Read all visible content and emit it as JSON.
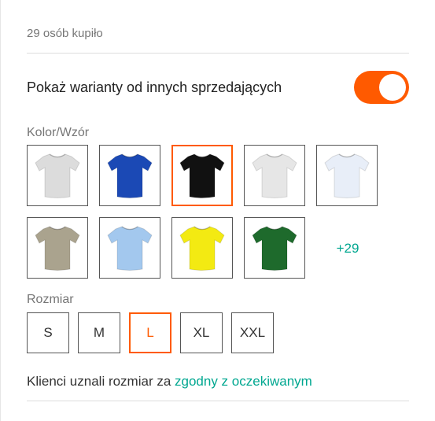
{
  "purchased_text": "29 osób kupiło",
  "toggle": {
    "label": "Pokaż warianty od innych sprzedających",
    "on": true,
    "color": "#ff5a00"
  },
  "color_section": {
    "label": "Kolor/Wzór",
    "swatches": [
      {
        "name": "light-gray",
        "color": "#dcdcdc",
        "selected": false
      },
      {
        "name": "royal-blue",
        "color": "#1b49b5",
        "selected": false
      },
      {
        "name": "black",
        "color": "#111111",
        "selected": true
      },
      {
        "name": "white-gray",
        "color": "#e6e6e6",
        "selected": false
      },
      {
        "name": "pale-white",
        "color": "#e8eef8",
        "selected": false
      },
      {
        "name": "khaki",
        "color": "#aaa38e",
        "selected": false
      },
      {
        "name": "sky-blue",
        "color": "#a3c8ee",
        "selected": false
      },
      {
        "name": "yellow",
        "color": "#f3ea12",
        "selected": false
      },
      {
        "name": "bottle-green",
        "color": "#1e6a2c",
        "selected": false
      }
    ],
    "more_label": "+29"
  },
  "size_section": {
    "label": "Rozmiar",
    "sizes": [
      "S",
      "M",
      "L",
      "XL",
      "XXL"
    ],
    "selected": "L"
  },
  "fit": {
    "prefix": "Klienci uznali rozmiar za ",
    "link": "zgodny z oczekiwanym"
  },
  "accent_color": "#ff5a00",
  "link_color": "#00a790"
}
